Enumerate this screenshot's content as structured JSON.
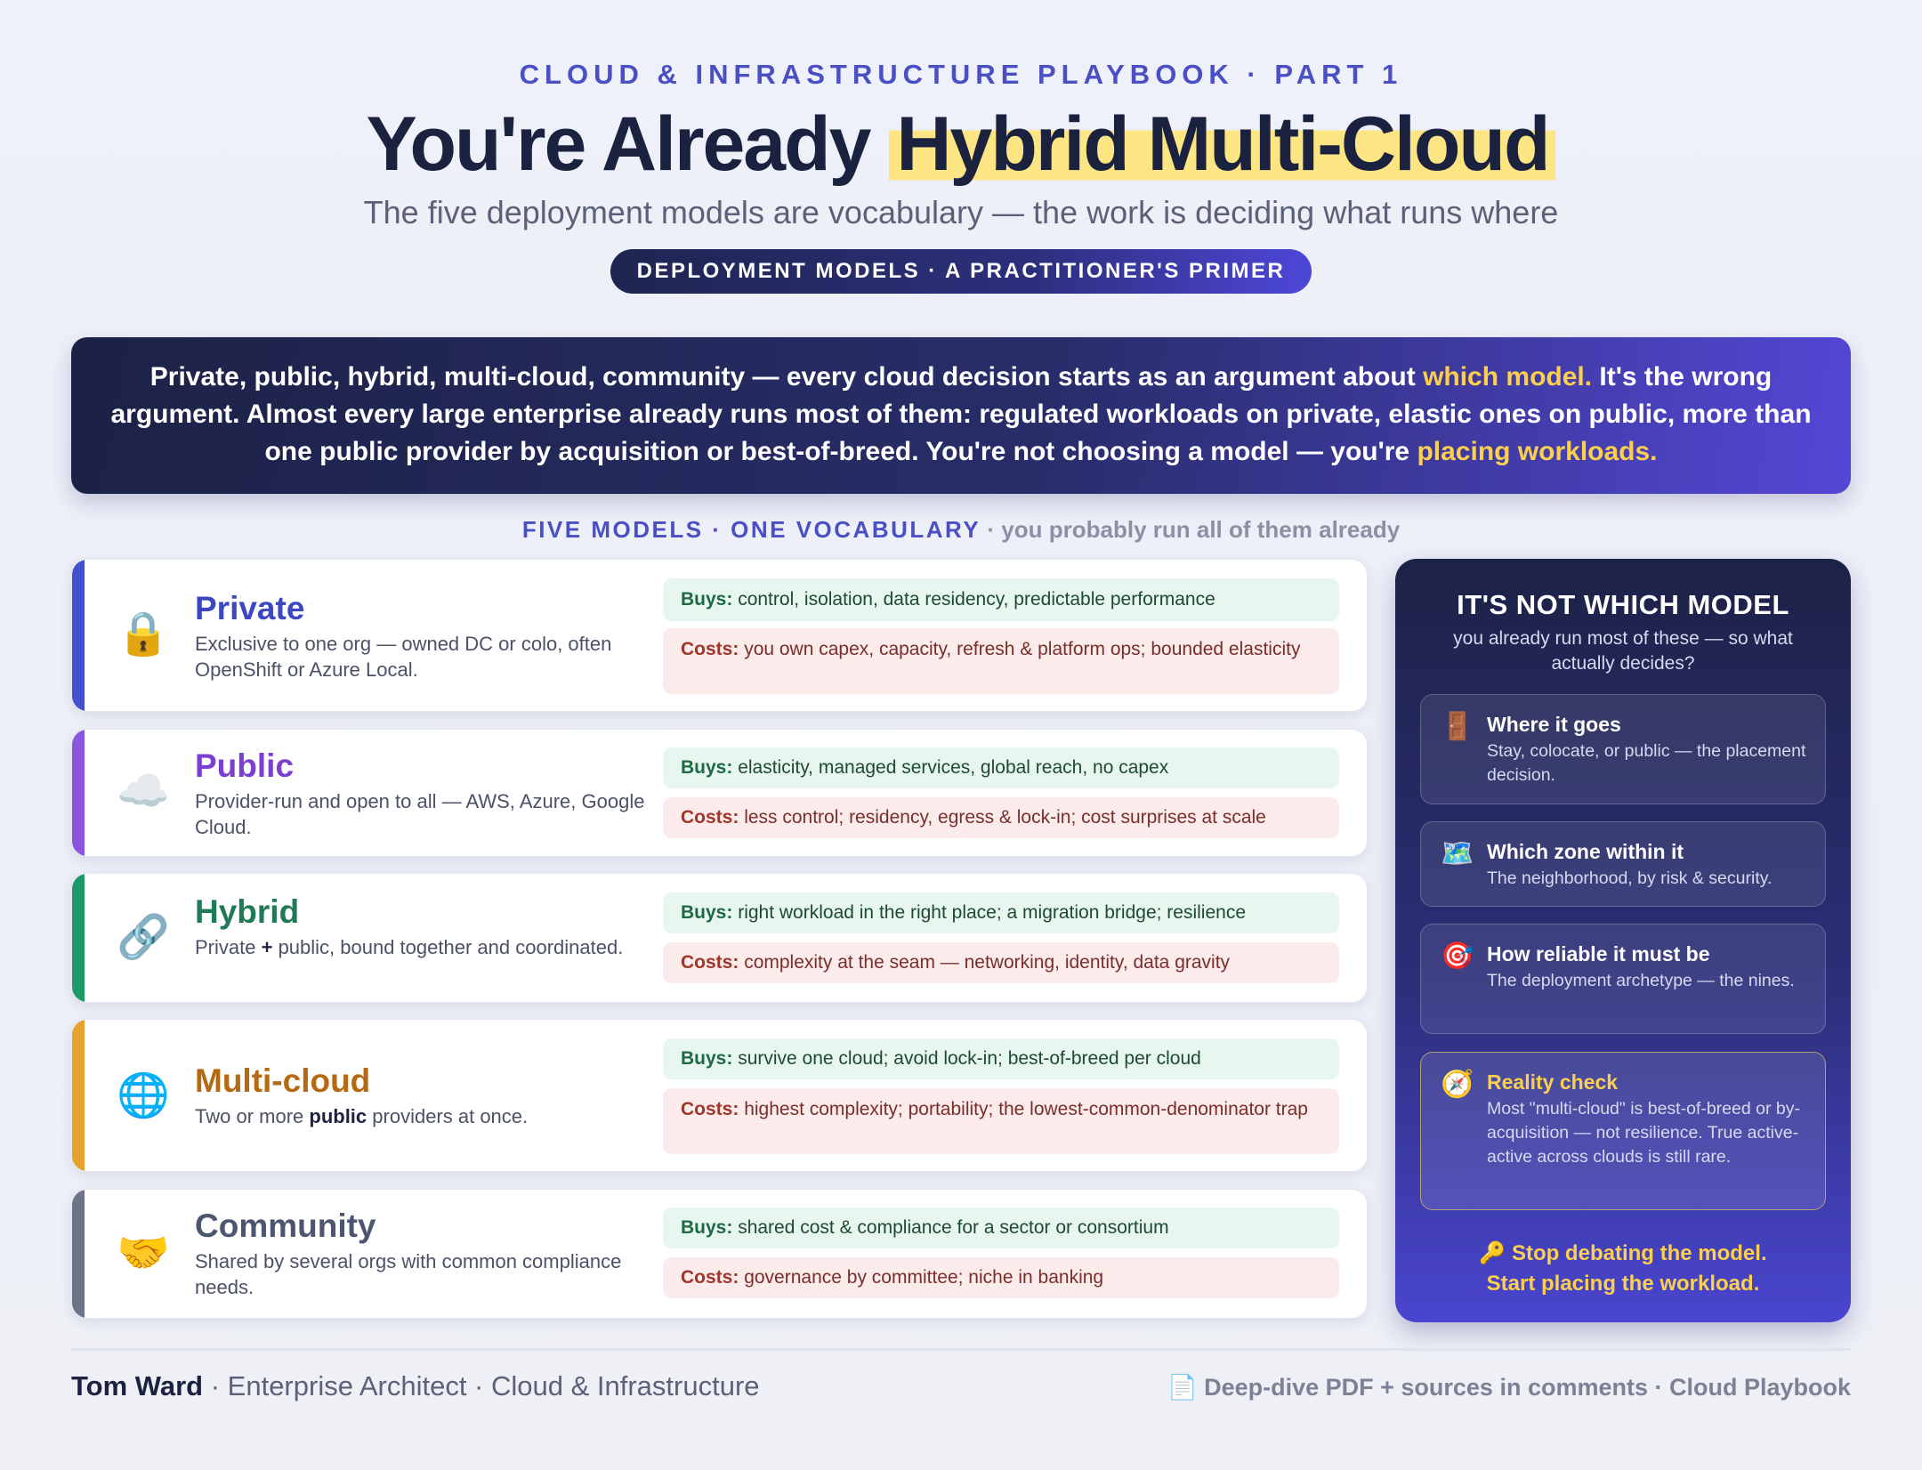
{
  "header": {
    "kicker": "CLOUD & INFRASTRUCTURE PLAYBOOK · PART 1",
    "title_pre": "You're Already ",
    "title_highlight": "Hybrid Multi-Cloud",
    "subtitle": "The five deployment models are vocabulary — the work is deciding what runs where",
    "pill": "DEPLOYMENT MODELS · A PRACTITIONER'S PRIMER"
  },
  "banner": {
    "part1": "Private, public, hybrid, multi-cloud, community — every cloud decision starts as an argument about ",
    "hl1": "which model.",
    "part2": " It's the wrong argument. Almost every large enterprise already runs most of them: regulated workloads on private, elastic ones on public, more than one public provider by acquisition or best-of-breed. You're not choosing a model — you're ",
    "hl2": "placing workloads."
  },
  "section_label": {
    "strong": "FIVE MODELS · ONE VOCABULARY",
    "soft": " · you probably run all of them already"
  },
  "labels": {
    "buys": "Buys:",
    "costs": "Costs:"
  },
  "models": [
    {
      "name": "Private",
      "icon": "lock-icon",
      "glyph": "🔒",
      "color": "#3d47c2",
      "desc": "Exclusive to one org — owned DC or colo, often OpenShift or Azure Local.",
      "buys": "control, isolation, data residency, predictable performance",
      "costs": "you own capex, capacity, refresh & platform ops; bounded elasticity"
    },
    {
      "name": "Public",
      "icon": "cloud-icon",
      "glyph": "☁️",
      "color": "#7a3fd0",
      "desc": "Provider-run and open to all — AWS, Azure, Google Cloud.",
      "buys": "elasticity, managed services, global reach, no capex",
      "costs": "less control; residency, egress & lock-in; cost surprises at scale"
    },
    {
      "name": "Hybrid",
      "icon": "link-icon",
      "glyph": "🔗",
      "color": "#1f7a55",
      "desc_pre": "Private ",
      "desc_bold": "+",
      "desc_post": " public, bound together and coordinated.",
      "buys": "right workload in the right place; a migration bridge; resilience",
      "costs": "complexity at the seam — networking, identity, data gravity"
    },
    {
      "name": "Multi-cloud",
      "icon": "globe-icon",
      "glyph": "🌐",
      "color": "#b56a12",
      "desc_pre": "Two or more ",
      "desc_bold": "public",
      "desc_post": " providers at once.",
      "buys": "survive one cloud; avoid lock-in; best-of-breed per cloud",
      "costs": "highest complexity; portability; the lowest-common-denominator trap"
    },
    {
      "name": "Community",
      "icon": "handshake-icon",
      "glyph": "🤝",
      "color": "#4d5670",
      "desc": "Shared by several orgs with common compliance needs.",
      "buys": "shared cost & compliance for a sector or consortium",
      "costs": "governance by committee; niche in banking"
    }
  ],
  "colors": {
    "bar_private": "#4450cc",
    "bar_public": "#8c55de",
    "bar_hybrid": "#1e9a6a",
    "bar_multicloud": "#e6a22c",
    "bar_community": "#6c7489"
  },
  "panel": {
    "title": "IT'S NOT WHICH MODEL",
    "subtitle": "you already run most of these — so what actually decides?",
    "items": [
      {
        "icon": "door-icon",
        "glyph": "🚪",
        "title": "Where it goes",
        "desc": "Stay, colocate, or public — the placement decision."
      },
      {
        "icon": "map-icon",
        "glyph": "🗺️",
        "title": "Which zone within it",
        "desc": "The neighborhood, by risk & security."
      },
      {
        "icon": "target-icon",
        "glyph": "🎯",
        "title": "How reliable it must be",
        "desc": "The deployment archetype — the nines."
      },
      {
        "icon": "compass-icon",
        "glyph": "🧭",
        "title": "Reality check",
        "desc": "Most \"multi-cloud\" is best-of-breed or by-acquisition — not resilience. True active-active across clouds is still rare."
      }
    ],
    "cta_line1": "🔑 Stop debating the model.",
    "cta_line2": "Start placing the workload."
  },
  "footer": {
    "author": "Tom Ward",
    "role": " · Enterprise Architect · Cloud & Infrastructure",
    "right": "📄 Deep-dive PDF + sources in comments · Cloud Playbook"
  }
}
